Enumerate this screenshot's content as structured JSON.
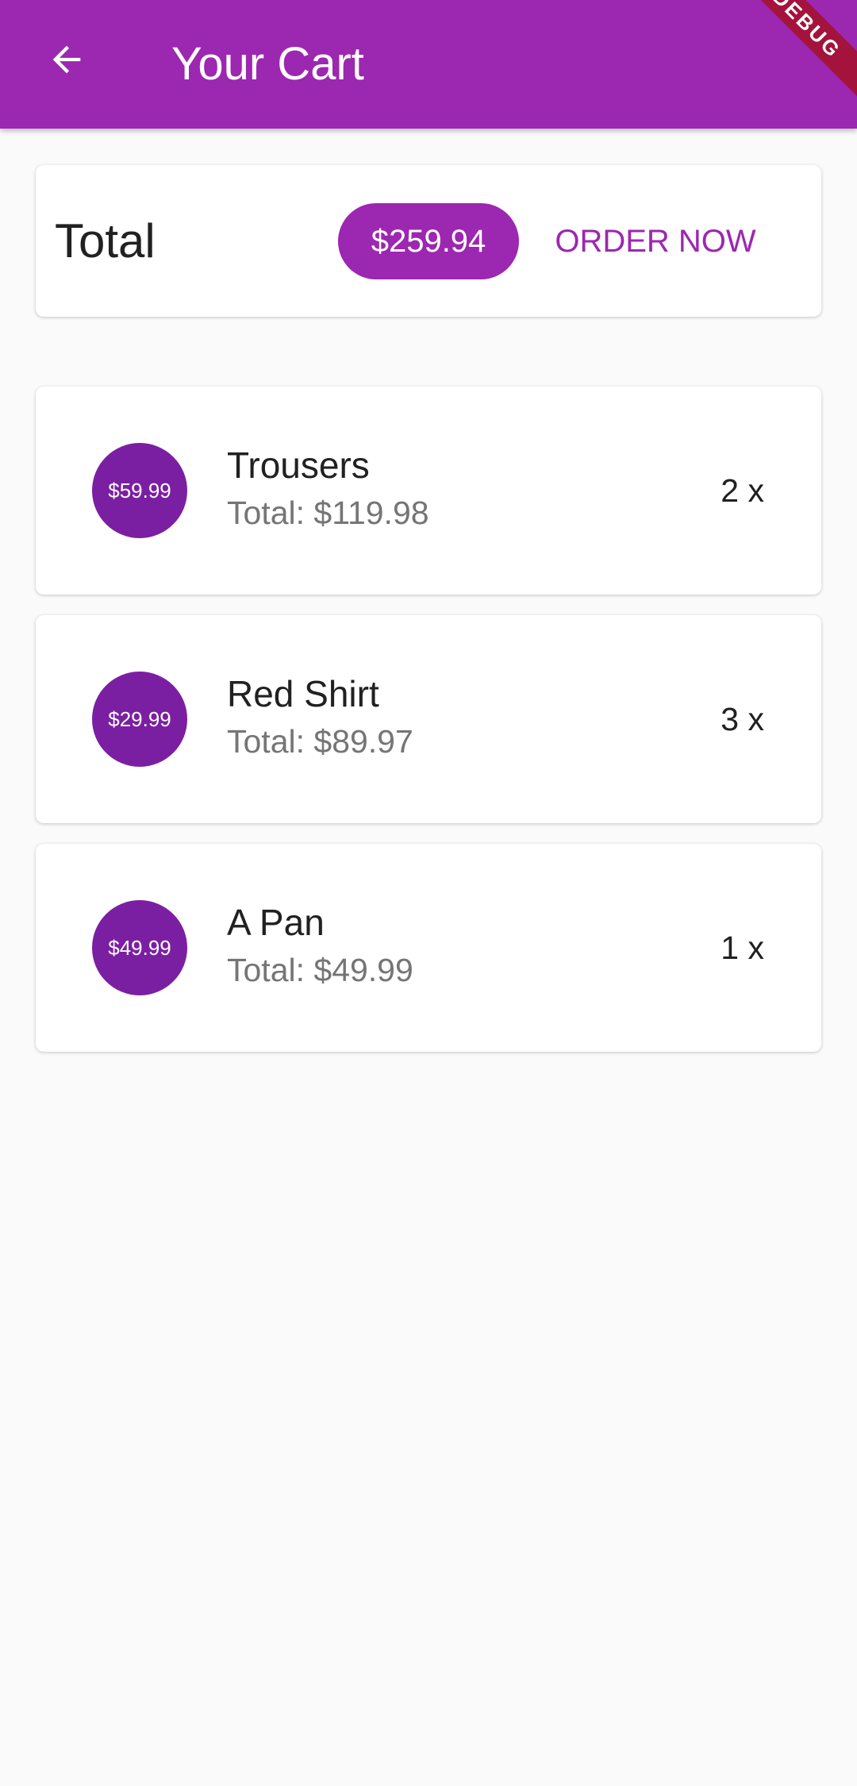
{
  "app_bar": {
    "title": "Your Cart",
    "back_icon": "arrow-back-icon",
    "debug_banner": "DEBUG",
    "color": "#9c27b0"
  },
  "summary": {
    "label": "Total",
    "amount": "$259.94",
    "order_label": "ORDER NOW"
  },
  "items": [
    {
      "price": "$59.99",
      "title": "Trousers",
      "subtitle": "Total: $119.98",
      "quantity": "2 x"
    },
    {
      "price": "$29.99",
      "title": "Red Shirt",
      "subtitle": "Total: $89.97",
      "quantity": "3 x"
    },
    {
      "price": "$49.99",
      "title": "A Pan",
      "subtitle": "Total: $49.99",
      "quantity": "1 x"
    }
  ]
}
